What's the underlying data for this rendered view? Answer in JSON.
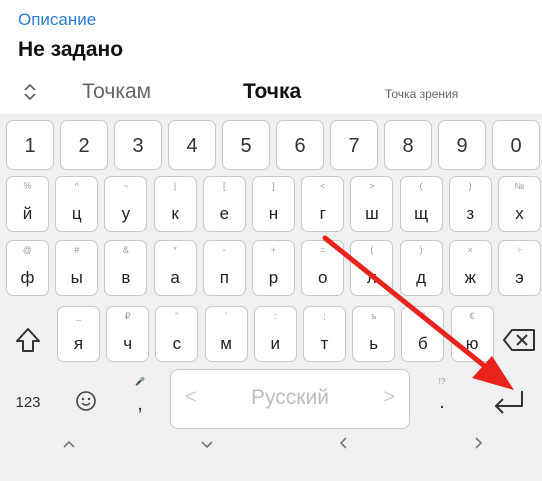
{
  "field": {
    "label": "Описание",
    "value": "Не задано"
  },
  "suggestions": {
    "left": "Точкам",
    "center": "Точка",
    "right": "Точка зрения",
    "toggle_icon": "expand-collapse-icon"
  },
  "number_row": [
    "1",
    "2",
    "3",
    "4",
    "5",
    "6",
    "7",
    "8",
    "9",
    "0"
  ],
  "row1": [
    {
      "main": "й",
      "hint": "%"
    },
    {
      "main": "ц",
      "hint": "^"
    },
    {
      "main": "у",
      "hint": "~"
    },
    {
      "main": "к",
      "hint": "|"
    },
    {
      "main": "е",
      "hint": "["
    },
    {
      "main": "н",
      "hint": "]"
    },
    {
      "main": "г",
      "hint": "<"
    },
    {
      "main": "ш",
      "hint": ">"
    },
    {
      "main": "щ",
      "hint": "("
    },
    {
      "main": "з",
      "hint": ")"
    },
    {
      "main": "х",
      "hint": "№"
    }
  ],
  "row2": [
    {
      "main": "ф",
      "hint": "@"
    },
    {
      "main": "ы",
      "hint": "#"
    },
    {
      "main": "в",
      "hint": "&"
    },
    {
      "main": "а",
      "hint": "*"
    },
    {
      "main": "п",
      "hint": "-"
    },
    {
      "main": "р",
      "hint": "+"
    },
    {
      "main": "о",
      "hint": "="
    },
    {
      "main": "л",
      "hint": "("
    },
    {
      "main": "д",
      "hint": ")"
    },
    {
      "main": "ж",
      "hint": "×"
    },
    {
      "main": "э",
      "hint": "÷"
    }
  ],
  "row3": [
    {
      "main": "я",
      "hint": "_"
    },
    {
      "main": "ч",
      "hint": "₽"
    },
    {
      "main": "с",
      "hint": "\""
    },
    {
      "main": "м",
      "hint": "'"
    },
    {
      "main": "и",
      "hint": ":"
    },
    {
      "main": "т",
      "hint": ";"
    },
    {
      "main": "ь",
      "hint": "ъ"
    },
    {
      "main": "б",
      "hint": "$"
    },
    {
      "main": "ю",
      "hint": "€"
    }
  ],
  "bottom": {
    "numbers_label": "123",
    "emoji_icon": "emoji-icon",
    "comma": ",",
    "comma_hint": "🎤",
    "space_label": "Русский",
    "period": ".",
    "period_hint": "!?",
    "enter_icon": "enter-icon"
  },
  "nav": {
    "up": "up-chevron-icon",
    "down": "down-chevron-icon",
    "left": "left-chevron-icon",
    "right": "right-chevron-icon"
  },
  "colors": {
    "accent": "#2a7bd4",
    "arrow": "#e8231c"
  }
}
